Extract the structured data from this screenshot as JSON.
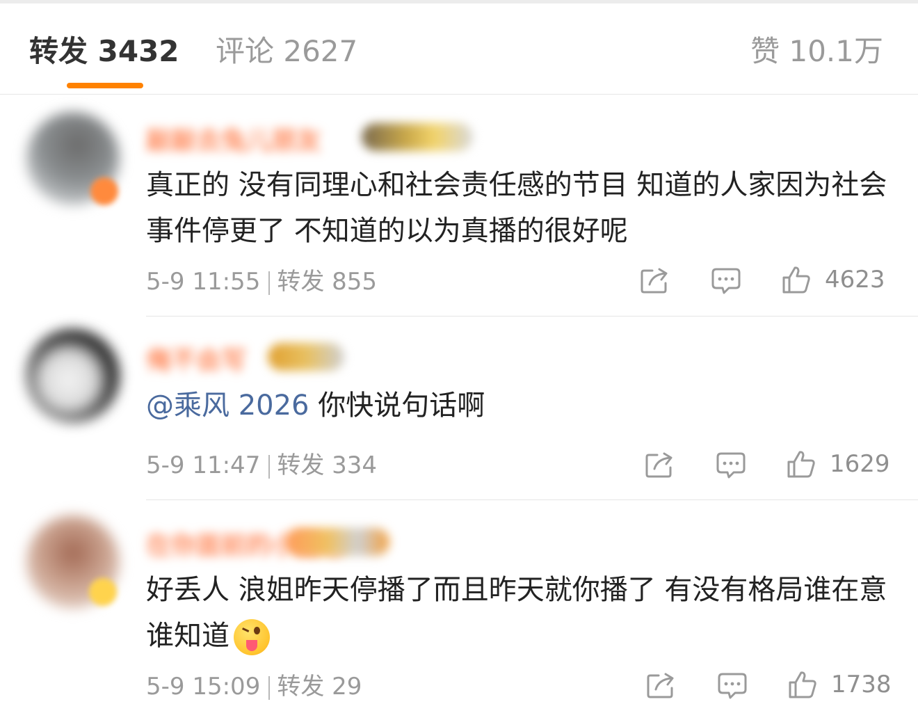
{
  "tabs": {
    "reposts": "转发 3432",
    "comments": "评论 2627",
    "likes": "赞 10.1万",
    "accent_color": "#ff8200"
  },
  "comments": [
    {
      "username": "敲敲去兔儿朋友",
      "text": "真正的 没有同理心和社会责任感的节目 知道的人家因为社会事件停更了 不知道的以为真播的很好呢",
      "time": "5-9 11:55",
      "reposts": "转发 855",
      "likes": "4623"
    },
    {
      "username": "俺不会写",
      "mention": "@乘风 2026",
      "text": " 你快说句话啊",
      "time": "5-9 11:47",
      "reposts": "转发 334",
      "likes": "1629"
    },
    {
      "username": "在你面前的小甜心",
      "text": "好丢人 浪姐昨天停播了而且昨天就你播了 有没有格局谁在意谁知道",
      "emoji": "tongue-wink-emoji",
      "time": "5-9 15:09",
      "reposts": "转发 29",
      "likes": "1738"
    }
  ],
  "icons": {
    "share": "share-icon",
    "comment": "comment-icon",
    "like": "thumbs-up-icon"
  },
  "colors": {
    "mention": "#4a6a9e",
    "meta": "#9a9a9a",
    "text": "#222222"
  }
}
